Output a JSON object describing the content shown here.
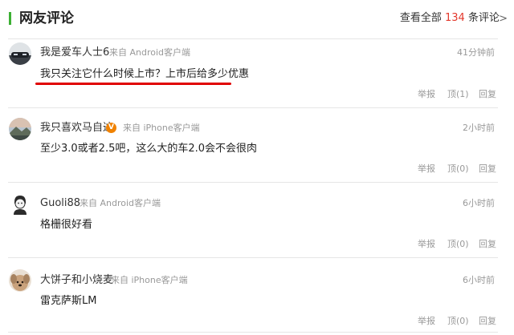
{
  "header": {
    "title": "网友评论",
    "viewall_prefix": "查看全部",
    "count": "134",
    "viewall_suffix": "条评论",
    "arrow": ">"
  },
  "actions": {
    "report": "举报",
    "dislike_prefix": "顶",
    "reply": "回复"
  },
  "comments": [
    {
      "user": "我是爱车人士6",
      "source": "来自 Android客户端",
      "time": "41分钟前",
      "text": "我只关注它什么时候上市？上市后给多少优惠",
      "up": "顶(1)",
      "verified": false
    },
    {
      "user": "我只喜欢马自达",
      "source": "来自 iPhone客户端",
      "time": "2小时前",
      "text": "至少3.0或者2.5吧，这么大的车2.0会不会很肉",
      "up": "顶(0)",
      "verified": true,
      "badge": "V"
    },
    {
      "user": "Guoli88",
      "source": "来自 Android客户端",
      "time": "6小时前",
      "text": "格栅很好看",
      "up": "顶(0)",
      "verified": false
    },
    {
      "user": "大饼子和小烧麦",
      "source": "来自 iPhone客户端",
      "time": "6小时前",
      "text": "雷克萨斯LM",
      "up": "顶(0)",
      "verified": false
    }
  ],
  "colors": {
    "accent_green": "#3cb034",
    "count_red": "#e3382c",
    "underline_red": "#e00000",
    "badge_orange": "#f08200"
  }
}
